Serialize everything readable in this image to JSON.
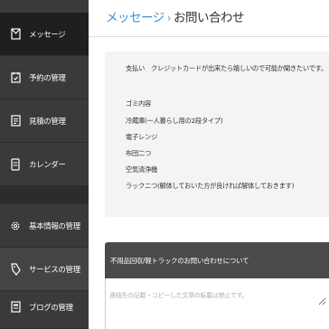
{
  "sidebar": {
    "items": [
      {
        "label": "メッセージ",
        "icon": "message-icon"
      },
      {
        "label": "予約の管理",
        "icon": "reservation-icon"
      },
      {
        "label": "見積の管理",
        "icon": "estimate-icon"
      },
      {
        "label": "カレンダー",
        "icon": "calendar-icon"
      },
      {
        "label": "基本情報の管理",
        "icon": "settings-icon"
      },
      {
        "label": "サービスの管理",
        "icon": "tag-icon"
      },
      {
        "label": "ブログの管理",
        "icon": "blog-icon"
      }
    ]
  },
  "header": {
    "breadcrumb_link": "メッセージ",
    "separator": "›",
    "current": "お問い合わせ"
  },
  "message": {
    "lines": [
      "支払い　クレジットカードが出来たら嬉しいので可能か聞きたいです。",
      "",
      "ゴミ内容",
      "冷蔵庫(一人暮らし用の2段タイプ)",
      "電子レンジ",
      "布団二つ",
      "空気清浄機",
      "ラックニつ(解体しておいた方が良ければ解体しておきます)"
    ]
  },
  "reply": {
    "header": "不用品回収/軽トラックのお問い合わせについて",
    "placeholder": "連絡先の記載・コピーした文章の転載は禁止です。"
  },
  "colors": {
    "sidebar_bg": "#3a3a3a",
    "sidebar_active": "#1f1f1f",
    "link": "#3b8fd6",
    "message_bg": "#f4f4f4",
    "reply_header_bg": "#4a4a4a"
  }
}
